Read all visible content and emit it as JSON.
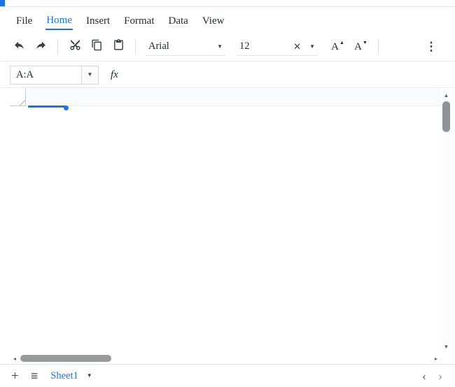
{
  "colors": {
    "accent": "#1a73e8",
    "toolbar_icon": "#3c4043",
    "scrollbar_thumb": "#8f9296"
  },
  "menu_bar": {
    "items": [
      {
        "label": "File",
        "active": false
      },
      {
        "label": "Home",
        "active": true
      },
      {
        "label": "Insert",
        "active": false
      },
      {
        "label": "Format",
        "active": false
      },
      {
        "label": "Data",
        "active": false
      },
      {
        "label": "View",
        "active": false
      }
    ]
  },
  "toolbar": {
    "font_family": {
      "value": "Arial"
    },
    "font_size": {
      "value": "12"
    },
    "letter_a": "A"
  },
  "formula_bar": {
    "name_box": {
      "value": "A:A"
    },
    "fx_label": "fx"
  },
  "grid": {
    "selected_range": "A:A"
  },
  "sheet_bar": {
    "sheets": [
      {
        "label": "Sheet1",
        "active": true
      }
    ]
  },
  "icons": {
    "caret_down": "▼",
    "clear_x": "✕",
    "more_vertical": "⋮",
    "plus": "+",
    "hamburger": "≡",
    "chevron_left": "‹",
    "chevron_right": "›",
    "scroll_up": "▲",
    "scroll_down": "▼",
    "scroll_left": "◂",
    "scroll_right": "▸",
    "triangle_up": "▲",
    "triangle_down": "▼"
  }
}
